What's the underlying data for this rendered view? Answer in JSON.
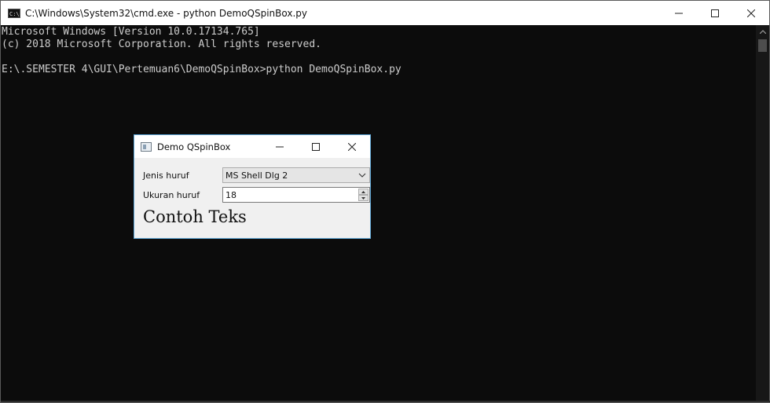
{
  "cmd": {
    "title": "C:\\Windows\\System32\\cmd.exe - python  DemoQSpinBox.py",
    "icon": "cmd-prompt-icon",
    "lines": [
      "Microsoft Windows [Version 10.0.17134.765]",
      "(c) 2018 Microsoft Corporation. All rights reserved.",
      "",
      "E:\\.SEMESTER 4\\GUI\\Pertemuan6\\DemoQSpinBox>python DemoQSpinBox.py"
    ]
  },
  "dialog": {
    "title": "Demo QSpinBox",
    "font_label": "Jenis huruf",
    "font_value": "MS Shell Dlg 2",
    "size_label": "Ukuran huruf",
    "size_value": "18",
    "sample_text": "Contoh Teks"
  },
  "colors": {
    "console_bg": "#0c0c0c",
    "console_text": "#cccccc",
    "dialog_border": "#5fa8d8"
  }
}
